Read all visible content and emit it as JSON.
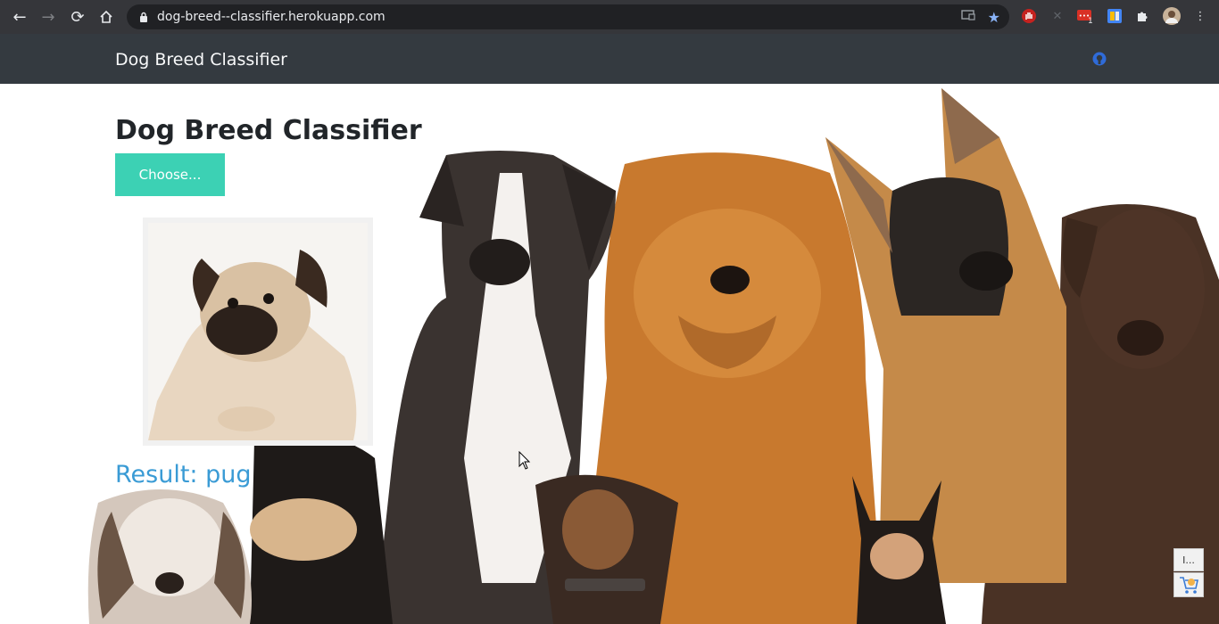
{
  "browser": {
    "url": "dog-breed--classifier.herokuapp.com",
    "ext_badge": "1"
  },
  "navbar": {
    "brand": "Dog Breed Classifier"
  },
  "main": {
    "title": "Dog Breed Classifier",
    "choose_label": "Choose...",
    "result_text": "Result: pug"
  },
  "widgets": {
    "tiny_label": "I..."
  },
  "colors": {
    "navbar": "#343a40",
    "accent_button": "#3cd1b4",
    "result": "#3a9bd5"
  }
}
